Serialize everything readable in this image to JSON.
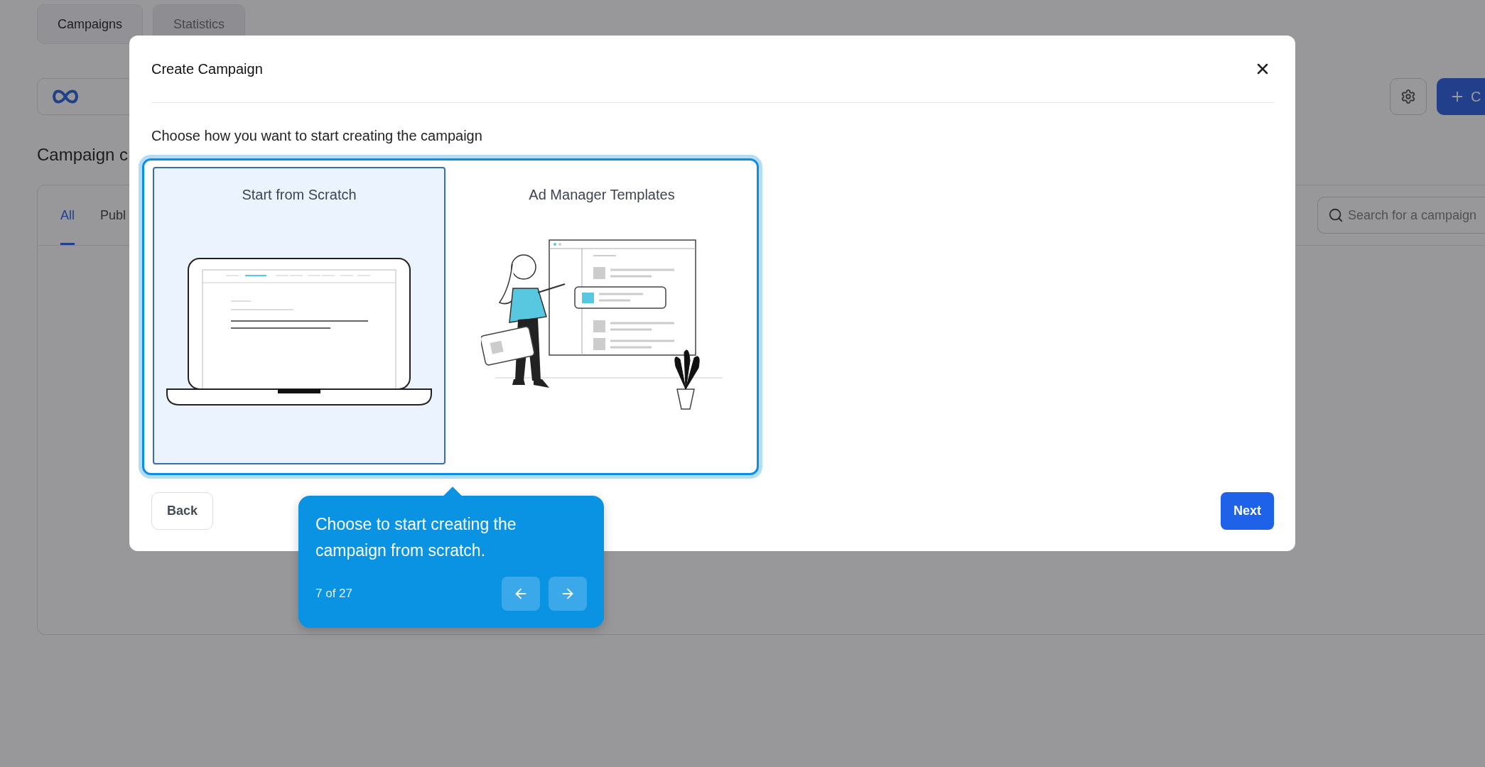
{
  "background": {
    "tabs": [
      {
        "label": "Campaigns",
        "selected": true
      },
      {
        "label": "Statistics",
        "selected": false
      }
    ],
    "heading": "Campaign c",
    "filter_tabs": [
      {
        "label": "All",
        "selected": true
      },
      {
        "label": "Publ",
        "selected": false
      }
    ],
    "search": {
      "placeholder": "Search for a campaign"
    },
    "create_button": {
      "label": "C"
    }
  },
  "modal": {
    "title": "Create Campaign",
    "prompt": "Choose how you want to start creating the campaign",
    "options": [
      {
        "kind": "scratch",
        "label": "Start from Scratch",
        "selected": true
      },
      {
        "kind": "templates",
        "label": "Ad Manager Templates",
        "selected": false
      }
    ],
    "back": "Back",
    "next": "Next"
  },
  "tooltip": {
    "text": "Choose to start creating the campaign from scratch.",
    "step": "7 of 27"
  }
}
